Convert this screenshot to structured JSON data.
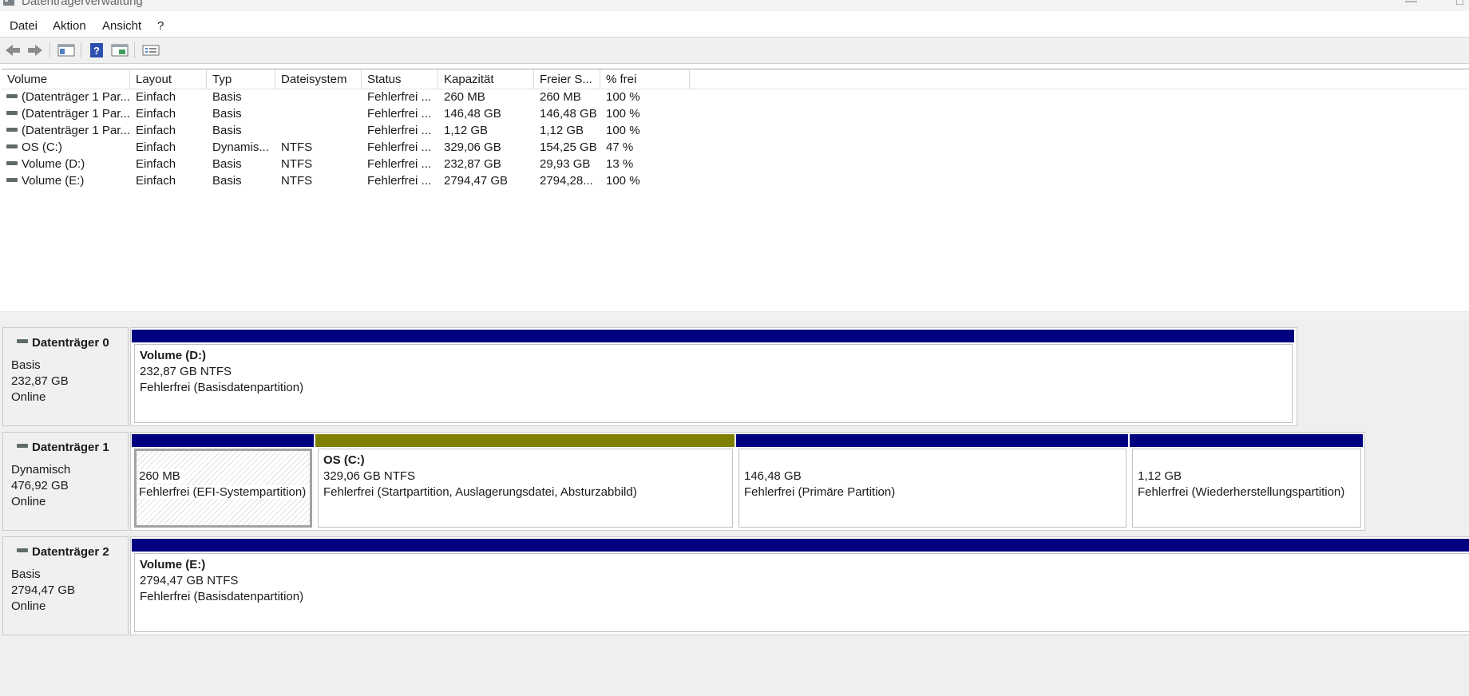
{
  "window": {
    "title": "Datenträgerverwaltung"
  },
  "menu": [
    "Datei",
    "Aktion",
    "Ansicht",
    "?"
  ],
  "toolbar": [
    "back-icon",
    "forward-icon",
    "console-tree-icon",
    "help-icon",
    "properties-icon",
    "settings-icon"
  ],
  "columns": [
    "Volume",
    "Layout",
    "Typ",
    "Dateisystem",
    "Status",
    "Kapazität",
    "Freier S...",
    "% frei"
  ],
  "volumes": [
    {
      "volume": "(Datenträger 1 Par...",
      "layout": "Einfach",
      "typ": "Basis",
      "fs": "",
      "status": "Fehlerfrei ...",
      "cap": "260 MB",
      "free": "260 MB",
      "pct": "100 %"
    },
    {
      "volume": "(Datenträger 1 Par...",
      "layout": "Einfach",
      "typ": "Basis",
      "fs": "",
      "status": "Fehlerfrei ...",
      "cap": "146,48 GB",
      "free": "146,48 GB",
      "pct": "100 %"
    },
    {
      "volume": "(Datenträger 1 Par...",
      "layout": "Einfach",
      "typ": "Basis",
      "fs": "",
      "status": "Fehlerfrei ...",
      "cap": "1,12 GB",
      "free": "1,12 GB",
      "pct": "100 %"
    },
    {
      "volume": "OS (C:)",
      "layout": "Einfach",
      "typ": "Dynamis...",
      "fs": "NTFS",
      "status": "Fehlerfrei ...",
      "cap": "329,06 GB",
      "free": "154,25 GB",
      "pct": "47 %"
    },
    {
      "volume": "Volume (D:)",
      "layout": "Einfach",
      "typ": "Basis",
      "fs": "NTFS",
      "status": "Fehlerfrei ...",
      "cap": "232,87 GB",
      "free": "29,93 GB",
      "pct": "13 %"
    },
    {
      "volume": "Volume (E:)",
      "layout": "Einfach",
      "typ": "Basis",
      "fs": "NTFS",
      "status": "Fehlerfrei ...",
      "cap": "2794,47 GB",
      "free": "2794,28...",
      "pct": "100 %"
    }
  ],
  "disks": [
    {
      "name": "Datenträger 0",
      "type": "Basis",
      "size": "232,87 GB",
      "state": "Online",
      "partitions": [
        {
          "title": "Volume  (D:)",
          "size": "232,87 GB NTFS",
          "status": "Fehlerfrei (Basisdatenpartition)",
          "bar": "#000080"
        }
      ]
    },
    {
      "name": "Datenträger 1",
      "type": "Dynamisch",
      "size": "476,92 GB",
      "state": "Online",
      "partitions": [
        {
          "title": "",
          "size": "260 MB",
          "status": "Fehlerfrei (EFI-Systempartition)",
          "bar": "#000080",
          "selected": true
        },
        {
          "title": "OS  (C:)",
          "size": "329,06 GB NTFS",
          "status": "Fehlerfrei (Startpartition, Auslagerungsdatei, Absturzabbild)",
          "bar": "#808000"
        },
        {
          "title": "",
          "size": "146,48 GB",
          "status": "Fehlerfrei (Primäre Partition)",
          "bar": "#000080"
        },
        {
          "title": "",
          "size": "1,12 GB",
          "status": "Fehlerfrei (Wiederherstellungspartition)",
          "bar": "#000080"
        }
      ]
    },
    {
      "name": "Datenträger 2",
      "type": "Basis",
      "size": "2794,47 GB",
      "state": "Online",
      "partitions": [
        {
          "title": "Volume  (E:)",
          "size": "2794,47 GB NTFS",
          "status": "Fehlerfrei (Basisdatenpartition)",
          "bar": "#000080"
        }
      ]
    }
  ]
}
